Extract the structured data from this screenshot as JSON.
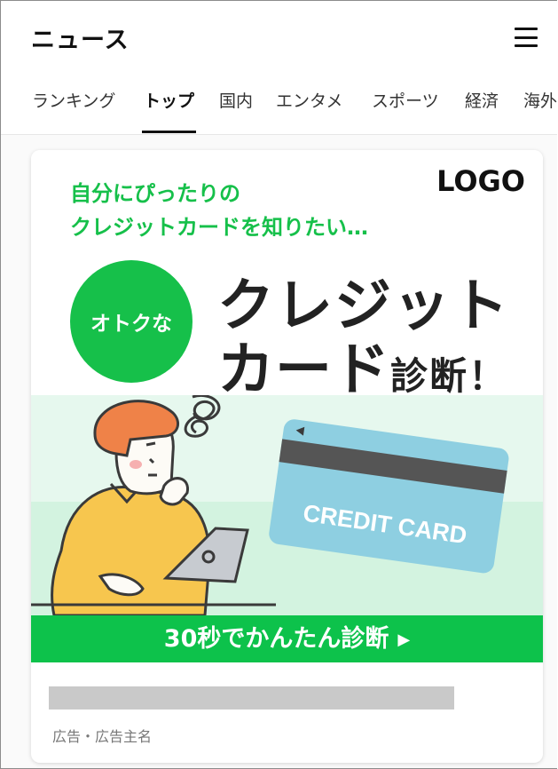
{
  "app": {
    "title": "ニュース"
  },
  "icons": {
    "menu": "hamburger-menu-icon",
    "cta_arrow": "play-arrow-icon"
  },
  "tabs": [
    {
      "label": "ランキング",
      "active": false
    },
    {
      "label": "トップ",
      "active": true
    },
    {
      "label": "国内",
      "active": false
    },
    {
      "label": "エンタメ",
      "active": false
    },
    {
      "label": "スポーツ",
      "active": false
    },
    {
      "label": "経済",
      "active": false
    },
    {
      "label": "海外",
      "active": false
    }
  ],
  "ad": {
    "lead_line1": "自分にぴったりの",
    "lead_line2": "クレジットカードを知りたい…",
    "logo": "LOGO",
    "badge": "オトクな",
    "headline_line1": "クレジット",
    "headline_line2_big": "カード",
    "headline_line2_small": "診断！",
    "card_text": "CREDIT CARD",
    "cta": "30秒でかんたん診断",
    "cta_arrow": "▶",
    "sponsor": "広告・広告主名"
  },
  "colors": {
    "accent_green": "#16c04a",
    "cta_green": "#0dc24b",
    "card_blue": "#8ecfe1",
    "scene_mint": "#e3f7ec",
    "shirt_yellow": "#f7c64e",
    "hair_orange": "#ef8248"
  }
}
